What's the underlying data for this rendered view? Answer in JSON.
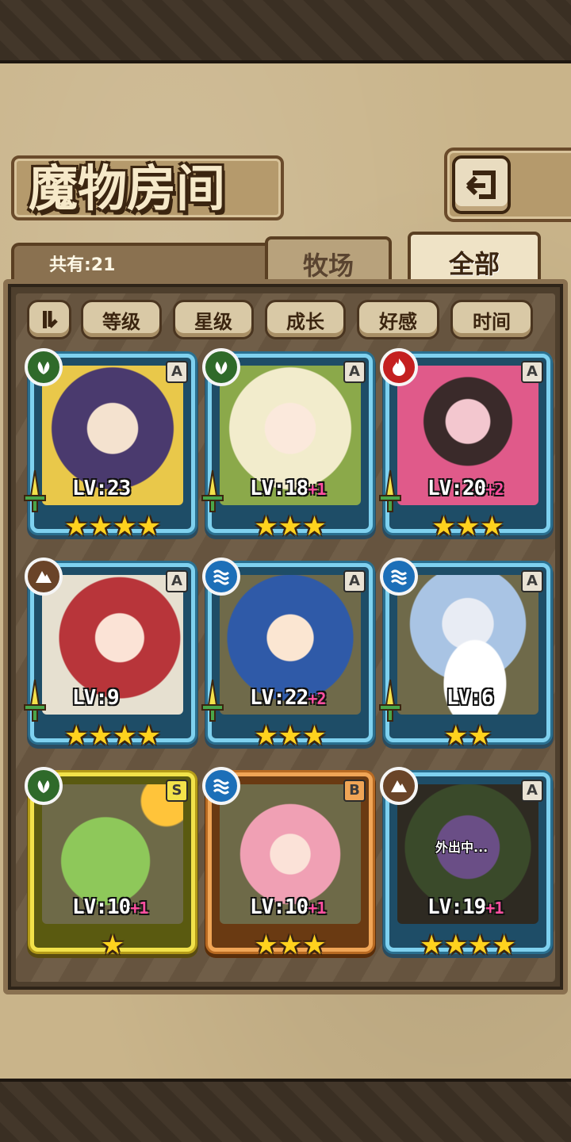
{
  "title": "魔物房间",
  "count_label": "共有:21",
  "tabs": [
    {
      "label": "牧场",
      "active": false
    },
    {
      "label": "全部",
      "active": true
    }
  ],
  "sort_buttons": [
    "等级",
    "星级",
    "成长",
    "好感",
    "时间"
  ],
  "monsters": [
    {
      "rarity": "A",
      "element": "grass",
      "level": "LV:23",
      "bonus": "",
      "stars": 4,
      "frame": "blue",
      "status": ""
    },
    {
      "rarity": "A",
      "element": "grass",
      "level": "LV:18",
      "bonus": "+1",
      "stars": 3,
      "frame": "blue",
      "status": ""
    },
    {
      "rarity": "A",
      "element": "fire",
      "level": "LV:20",
      "bonus": "+2",
      "stars": 3,
      "frame": "blue",
      "status": ""
    },
    {
      "rarity": "A",
      "element": "earth",
      "level": "LV:9",
      "bonus": "",
      "stars": 4,
      "frame": "blue",
      "status": ""
    },
    {
      "rarity": "A",
      "element": "water",
      "level": "LV:22",
      "bonus": "+2",
      "stars": 3,
      "frame": "blue",
      "status": ""
    },
    {
      "rarity": "A",
      "element": "water",
      "level": "LV:6",
      "bonus": "",
      "stars": 2,
      "frame": "blue",
      "status": ""
    },
    {
      "rarity": "S",
      "element": "grass",
      "level": "LV:10",
      "bonus": "+1",
      "stars": 1,
      "frame": "gold",
      "status": ""
    },
    {
      "rarity": "B",
      "element": "water",
      "level": "LV:10",
      "bonus": "+1",
      "stars": 3,
      "frame": "bronze",
      "status": ""
    },
    {
      "rarity": "A",
      "element": "earth",
      "level": "LV:19",
      "bonus": "+1",
      "stars": 4,
      "frame": "blue",
      "status": "外出中..."
    }
  ]
}
